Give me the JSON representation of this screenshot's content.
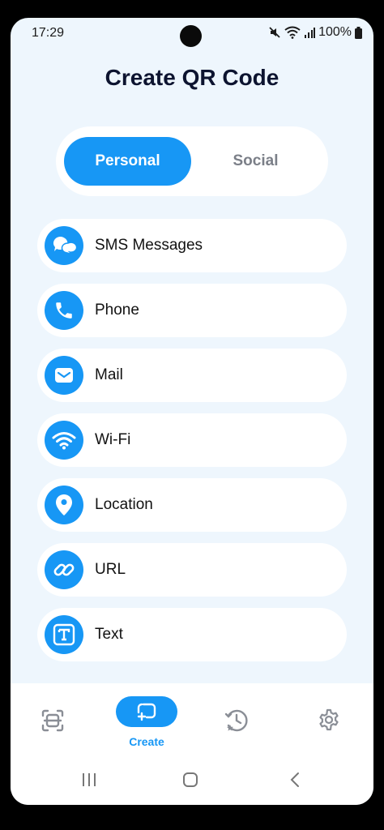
{
  "status_bar": {
    "time": "17:29",
    "battery": "100%",
    "icons": [
      "mute-icon",
      "wifi-icon",
      "signal-icon",
      "battery-icon"
    ]
  },
  "page": {
    "title": "Create QR Code"
  },
  "tabs": {
    "personal": "Personal",
    "social": "Social",
    "selected": "Personal"
  },
  "items": [
    {
      "label": "SMS Messages",
      "icon": "chat-bubbles-icon"
    },
    {
      "label": "Phone",
      "icon": "phone-icon"
    },
    {
      "label": "Mail",
      "icon": "mail-icon"
    },
    {
      "label": "Wi-Fi",
      "icon": "wifi-icon"
    },
    {
      "label": "Location",
      "icon": "location-pin-icon"
    },
    {
      "label": "URL",
      "icon": "link-icon"
    },
    {
      "label": "Text",
      "icon": "text-icon"
    }
  ],
  "bottom_nav": {
    "create_label": "Create",
    "items": [
      "scan-icon",
      "create-icon",
      "history-icon",
      "settings-icon"
    ]
  },
  "colors": {
    "accent": "#1797f5",
    "background": "#eef6fd",
    "card": "#ffffff",
    "title": "#0d1430"
  }
}
